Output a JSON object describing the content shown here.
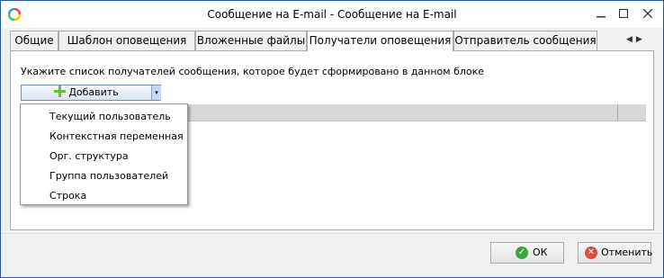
{
  "window": {
    "title": "Сообщение на E-mail - Сообщение на E-mail"
  },
  "tabs": [
    {
      "label": "Общие",
      "active": false
    },
    {
      "label": "Шаблон оповещения",
      "active": false
    },
    {
      "label": "Вложенные файлы",
      "active": false
    },
    {
      "label": "Получатели оповещения",
      "active": true
    },
    {
      "label": "Отправитель сообщения",
      "active": false
    }
  ],
  "tab_scroll": {
    "left_arrow": "◀",
    "right_arrow": "▶"
  },
  "recipients": {
    "instruction": "Укажите список получателей сообщения, которое будет сформировано в данном блоке",
    "add_button": {
      "label": "Добавить",
      "icon": "plus-icon",
      "dropdown_icon": "▾"
    },
    "menu": [
      "Текущий пользователь",
      "Контекстная переменная",
      "Орг. структура",
      "Группа пользователей",
      "Строка"
    ]
  },
  "footer": {
    "ok_label": "ОК",
    "cancel_label": "Отменить",
    "ok_icon_glyph": "✓",
    "cancel_icon_glyph": "✕"
  },
  "colors": {
    "accent": "#2b5797",
    "ok": "#3aa63a",
    "cancel": "#e04a3a"
  }
}
